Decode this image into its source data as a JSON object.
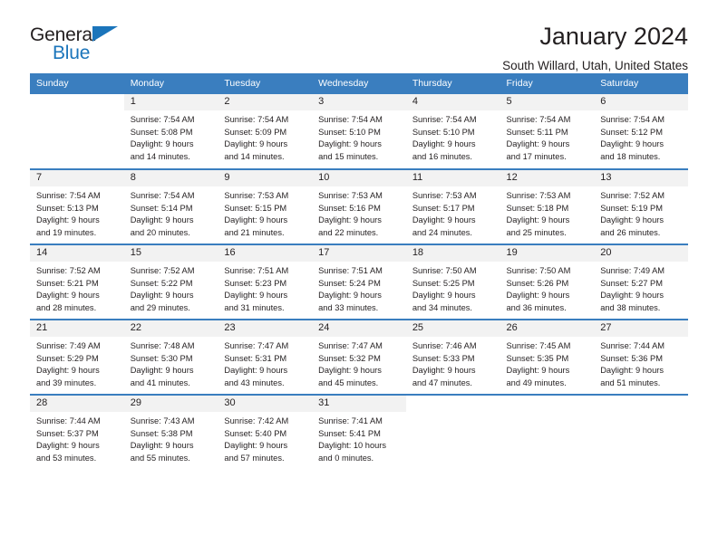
{
  "brand": {
    "name_top": "General",
    "name_bottom": "Blue",
    "accent_color": "#1b75bb"
  },
  "header": {
    "title": "January 2024",
    "subtitle": "South Willard, Utah, United States"
  },
  "theme": {
    "header_row_bg": "#3a7ebf",
    "daynum_bg": "#f2f2f2",
    "text_color": "#231f20"
  },
  "weekday_headers": [
    "Sunday",
    "Monday",
    "Tuesday",
    "Wednesday",
    "Thursday",
    "Friday",
    "Saturday"
  ],
  "labels": {
    "sunrise": "Sunrise:",
    "sunset": "Sunset:",
    "daylight": "Daylight:"
  },
  "weeks": [
    [
      {
        "day": "",
        "line1": "",
        "line2": "",
        "line3": "",
        "line4": ""
      },
      {
        "day": "1",
        "line1": "Sunrise: 7:54 AM",
        "line2": "Sunset: 5:08 PM",
        "line3": "Daylight: 9 hours",
        "line4": "and 14 minutes."
      },
      {
        "day": "2",
        "line1": "Sunrise: 7:54 AM",
        "line2": "Sunset: 5:09 PM",
        "line3": "Daylight: 9 hours",
        "line4": "and 14 minutes."
      },
      {
        "day": "3",
        "line1": "Sunrise: 7:54 AM",
        "line2": "Sunset: 5:10 PM",
        "line3": "Daylight: 9 hours",
        "line4": "and 15 minutes."
      },
      {
        "day": "4",
        "line1": "Sunrise: 7:54 AM",
        "line2": "Sunset: 5:10 PM",
        "line3": "Daylight: 9 hours",
        "line4": "and 16 minutes."
      },
      {
        "day": "5",
        "line1": "Sunrise: 7:54 AM",
        "line2": "Sunset: 5:11 PM",
        "line3": "Daylight: 9 hours",
        "line4": "and 17 minutes."
      },
      {
        "day": "6",
        "line1": "Sunrise: 7:54 AM",
        "line2": "Sunset: 5:12 PM",
        "line3": "Daylight: 9 hours",
        "line4": "and 18 minutes."
      }
    ],
    [
      {
        "day": "7",
        "line1": "Sunrise: 7:54 AM",
        "line2": "Sunset: 5:13 PM",
        "line3": "Daylight: 9 hours",
        "line4": "and 19 minutes."
      },
      {
        "day": "8",
        "line1": "Sunrise: 7:54 AM",
        "line2": "Sunset: 5:14 PM",
        "line3": "Daylight: 9 hours",
        "line4": "and 20 minutes."
      },
      {
        "day": "9",
        "line1": "Sunrise: 7:53 AM",
        "line2": "Sunset: 5:15 PM",
        "line3": "Daylight: 9 hours",
        "line4": "and 21 minutes."
      },
      {
        "day": "10",
        "line1": "Sunrise: 7:53 AM",
        "line2": "Sunset: 5:16 PM",
        "line3": "Daylight: 9 hours",
        "line4": "and 22 minutes."
      },
      {
        "day": "11",
        "line1": "Sunrise: 7:53 AM",
        "line2": "Sunset: 5:17 PM",
        "line3": "Daylight: 9 hours",
        "line4": "and 24 minutes."
      },
      {
        "day": "12",
        "line1": "Sunrise: 7:53 AM",
        "line2": "Sunset: 5:18 PM",
        "line3": "Daylight: 9 hours",
        "line4": "and 25 minutes."
      },
      {
        "day": "13",
        "line1": "Sunrise: 7:52 AM",
        "line2": "Sunset: 5:19 PM",
        "line3": "Daylight: 9 hours",
        "line4": "and 26 minutes."
      }
    ],
    [
      {
        "day": "14",
        "line1": "Sunrise: 7:52 AM",
        "line2": "Sunset: 5:21 PM",
        "line3": "Daylight: 9 hours",
        "line4": "and 28 minutes."
      },
      {
        "day": "15",
        "line1": "Sunrise: 7:52 AM",
        "line2": "Sunset: 5:22 PM",
        "line3": "Daylight: 9 hours",
        "line4": "and 29 minutes."
      },
      {
        "day": "16",
        "line1": "Sunrise: 7:51 AM",
        "line2": "Sunset: 5:23 PM",
        "line3": "Daylight: 9 hours",
        "line4": "and 31 minutes."
      },
      {
        "day": "17",
        "line1": "Sunrise: 7:51 AM",
        "line2": "Sunset: 5:24 PM",
        "line3": "Daylight: 9 hours",
        "line4": "and 33 minutes."
      },
      {
        "day": "18",
        "line1": "Sunrise: 7:50 AM",
        "line2": "Sunset: 5:25 PM",
        "line3": "Daylight: 9 hours",
        "line4": "and 34 minutes."
      },
      {
        "day": "19",
        "line1": "Sunrise: 7:50 AM",
        "line2": "Sunset: 5:26 PM",
        "line3": "Daylight: 9 hours",
        "line4": "and 36 minutes."
      },
      {
        "day": "20",
        "line1": "Sunrise: 7:49 AM",
        "line2": "Sunset: 5:27 PM",
        "line3": "Daylight: 9 hours",
        "line4": "and 38 minutes."
      }
    ],
    [
      {
        "day": "21",
        "line1": "Sunrise: 7:49 AM",
        "line2": "Sunset: 5:29 PM",
        "line3": "Daylight: 9 hours",
        "line4": "and 39 minutes."
      },
      {
        "day": "22",
        "line1": "Sunrise: 7:48 AM",
        "line2": "Sunset: 5:30 PM",
        "line3": "Daylight: 9 hours",
        "line4": "and 41 minutes."
      },
      {
        "day": "23",
        "line1": "Sunrise: 7:47 AM",
        "line2": "Sunset: 5:31 PM",
        "line3": "Daylight: 9 hours",
        "line4": "and 43 minutes."
      },
      {
        "day": "24",
        "line1": "Sunrise: 7:47 AM",
        "line2": "Sunset: 5:32 PM",
        "line3": "Daylight: 9 hours",
        "line4": "and 45 minutes."
      },
      {
        "day": "25",
        "line1": "Sunrise: 7:46 AM",
        "line2": "Sunset: 5:33 PM",
        "line3": "Daylight: 9 hours",
        "line4": "and 47 minutes."
      },
      {
        "day": "26",
        "line1": "Sunrise: 7:45 AM",
        "line2": "Sunset: 5:35 PM",
        "line3": "Daylight: 9 hours",
        "line4": "and 49 minutes."
      },
      {
        "day": "27",
        "line1": "Sunrise: 7:44 AM",
        "line2": "Sunset: 5:36 PM",
        "line3": "Daylight: 9 hours",
        "line4": "and 51 minutes."
      }
    ],
    [
      {
        "day": "28",
        "line1": "Sunrise: 7:44 AM",
        "line2": "Sunset: 5:37 PM",
        "line3": "Daylight: 9 hours",
        "line4": "and 53 minutes."
      },
      {
        "day": "29",
        "line1": "Sunrise: 7:43 AM",
        "line2": "Sunset: 5:38 PM",
        "line3": "Daylight: 9 hours",
        "line4": "and 55 minutes."
      },
      {
        "day": "30",
        "line1": "Sunrise: 7:42 AM",
        "line2": "Sunset: 5:40 PM",
        "line3": "Daylight: 9 hours",
        "line4": "and 57 minutes."
      },
      {
        "day": "31",
        "line1": "Sunrise: 7:41 AM",
        "line2": "Sunset: 5:41 PM",
        "line3": "Daylight: 10 hours",
        "line4": "and 0 minutes."
      },
      {
        "day": "",
        "line1": "",
        "line2": "",
        "line3": "",
        "line4": ""
      },
      {
        "day": "",
        "line1": "",
        "line2": "",
        "line3": "",
        "line4": ""
      },
      {
        "day": "",
        "line1": "",
        "line2": "",
        "line3": "",
        "line4": ""
      }
    ]
  ]
}
